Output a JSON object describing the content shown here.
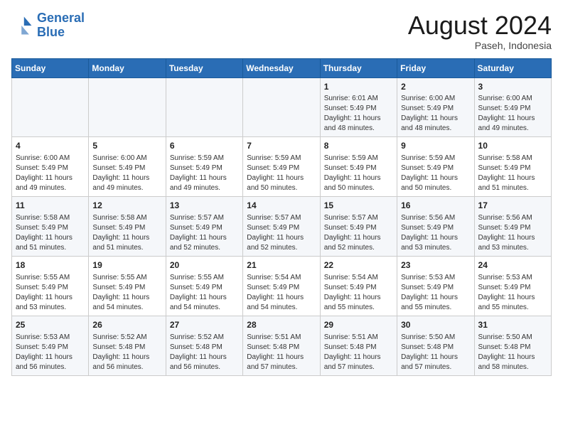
{
  "logo": {
    "line1": "General",
    "line2": "Blue"
  },
  "title": "August 2024",
  "subtitle": "Paseh, Indonesia",
  "days_of_week": [
    "Sunday",
    "Monday",
    "Tuesday",
    "Wednesday",
    "Thursday",
    "Friday",
    "Saturday"
  ],
  "weeks": [
    [
      {
        "day": "",
        "info": ""
      },
      {
        "day": "",
        "info": ""
      },
      {
        "day": "",
        "info": ""
      },
      {
        "day": "",
        "info": ""
      },
      {
        "day": "1",
        "info": "Sunrise: 6:01 AM\nSunset: 5:49 PM\nDaylight: 11 hours\nand 48 minutes."
      },
      {
        "day": "2",
        "info": "Sunrise: 6:00 AM\nSunset: 5:49 PM\nDaylight: 11 hours\nand 48 minutes."
      },
      {
        "day": "3",
        "info": "Sunrise: 6:00 AM\nSunset: 5:49 PM\nDaylight: 11 hours\nand 49 minutes."
      }
    ],
    [
      {
        "day": "4",
        "info": "Sunrise: 6:00 AM\nSunset: 5:49 PM\nDaylight: 11 hours\nand 49 minutes."
      },
      {
        "day": "5",
        "info": "Sunrise: 6:00 AM\nSunset: 5:49 PM\nDaylight: 11 hours\nand 49 minutes."
      },
      {
        "day": "6",
        "info": "Sunrise: 5:59 AM\nSunset: 5:49 PM\nDaylight: 11 hours\nand 49 minutes."
      },
      {
        "day": "7",
        "info": "Sunrise: 5:59 AM\nSunset: 5:49 PM\nDaylight: 11 hours\nand 50 minutes."
      },
      {
        "day": "8",
        "info": "Sunrise: 5:59 AM\nSunset: 5:49 PM\nDaylight: 11 hours\nand 50 minutes."
      },
      {
        "day": "9",
        "info": "Sunrise: 5:59 AM\nSunset: 5:49 PM\nDaylight: 11 hours\nand 50 minutes."
      },
      {
        "day": "10",
        "info": "Sunrise: 5:58 AM\nSunset: 5:49 PM\nDaylight: 11 hours\nand 51 minutes."
      }
    ],
    [
      {
        "day": "11",
        "info": "Sunrise: 5:58 AM\nSunset: 5:49 PM\nDaylight: 11 hours\nand 51 minutes."
      },
      {
        "day": "12",
        "info": "Sunrise: 5:58 AM\nSunset: 5:49 PM\nDaylight: 11 hours\nand 51 minutes."
      },
      {
        "day": "13",
        "info": "Sunrise: 5:57 AM\nSunset: 5:49 PM\nDaylight: 11 hours\nand 52 minutes."
      },
      {
        "day": "14",
        "info": "Sunrise: 5:57 AM\nSunset: 5:49 PM\nDaylight: 11 hours\nand 52 minutes."
      },
      {
        "day": "15",
        "info": "Sunrise: 5:57 AM\nSunset: 5:49 PM\nDaylight: 11 hours\nand 52 minutes."
      },
      {
        "day": "16",
        "info": "Sunrise: 5:56 AM\nSunset: 5:49 PM\nDaylight: 11 hours\nand 53 minutes."
      },
      {
        "day": "17",
        "info": "Sunrise: 5:56 AM\nSunset: 5:49 PM\nDaylight: 11 hours\nand 53 minutes."
      }
    ],
    [
      {
        "day": "18",
        "info": "Sunrise: 5:55 AM\nSunset: 5:49 PM\nDaylight: 11 hours\nand 53 minutes."
      },
      {
        "day": "19",
        "info": "Sunrise: 5:55 AM\nSunset: 5:49 PM\nDaylight: 11 hours\nand 54 minutes."
      },
      {
        "day": "20",
        "info": "Sunrise: 5:55 AM\nSunset: 5:49 PM\nDaylight: 11 hours\nand 54 minutes."
      },
      {
        "day": "21",
        "info": "Sunrise: 5:54 AM\nSunset: 5:49 PM\nDaylight: 11 hours\nand 54 minutes."
      },
      {
        "day": "22",
        "info": "Sunrise: 5:54 AM\nSunset: 5:49 PM\nDaylight: 11 hours\nand 55 minutes."
      },
      {
        "day": "23",
        "info": "Sunrise: 5:53 AM\nSunset: 5:49 PM\nDaylight: 11 hours\nand 55 minutes."
      },
      {
        "day": "24",
        "info": "Sunrise: 5:53 AM\nSunset: 5:49 PM\nDaylight: 11 hours\nand 55 minutes."
      }
    ],
    [
      {
        "day": "25",
        "info": "Sunrise: 5:53 AM\nSunset: 5:49 PM\nDaylight: 11 hours\nand 56 minutes."
      },
      {
        "day": "26",
        "info": "Sunrise: 5:52 AM\nSunset: 5:48 PM\nDaylight: 11 hours\nand 56 minutes."
      },
      {
        "day": "27",
        "info": "Sunrise: 5:52 AM\nSunset: 5:48 PM\nDaylight: 11 hours\nand 56 minutes."
      },
      {
        "day": "28",
        "info": "Sunrise: 5:51 AM\nSunset: 5:48 PM\nDaylight: 11 hours\nand 57 minutes."
      },
      {
        "day": "29",
        "info": "Sunrise: 5:51 AM\nSunset: 5:48 PM\nDaylight: 11 hours\nand 57 minutes."
      },
      {
        "day": "30",
        "info": "Sunrise: 5:50 AM\nSunset: 5:48 PM\nDaylight: 11 hours\nand 57 minutes."
      },
      {
        "day": "31",
        "info": "Sunrise: 5:50 AM\nSunset: 5:48 PM\nDaylight: 11 hours\nand 58 minutes."
      }
    ]
  ],
  "colors": {
    "header_bg": "#2a6db5",
    "header_text": "#ffffff",
    "odd_row_bg": "#f5f7fa",
    "even_row_bg": "#ffffff",
    "empty_bg": "#f0f0f0"
  }
}
